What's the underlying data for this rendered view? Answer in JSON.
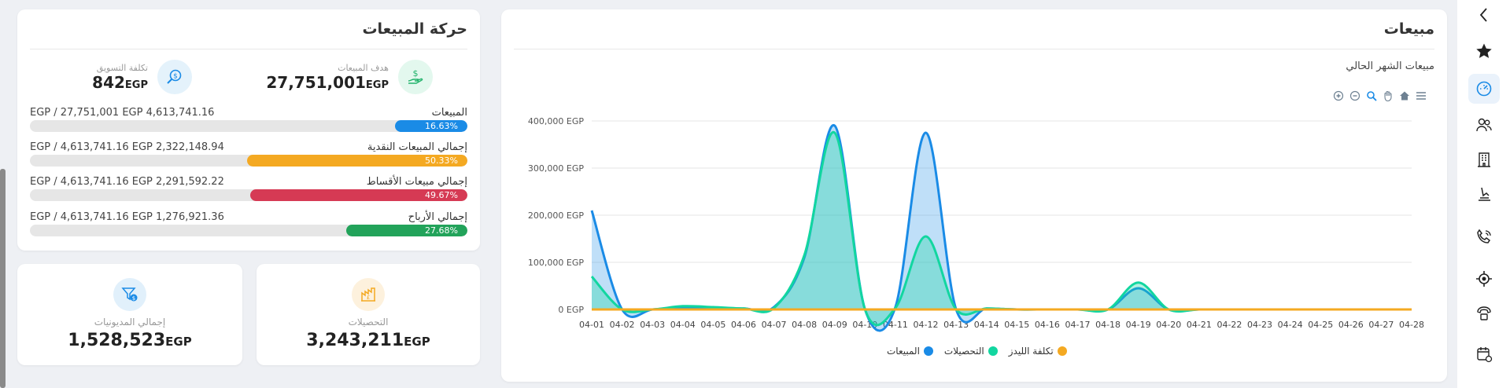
{
  "colors": {
    "sales": "#1a8be6",
    "collections": "#12d6a0",
    "leads_cost": "#f4a922"
  },
  "chart_card": {
    "title": "مبيعات",
    "subtitle": "مبيعات الشهر الحالي",
    "toolbar": [
      "zoom-in-icon",
      "zoom-out-icon",
      "search-zoom-icon",
      "pan-hand-icon",
      "home-icon",
      "menu-icon"
    ]
  },
  "chart_data": {
    "type": "area",
    "x": [
      "04-01",
      "04-02",
      "04-03",
      "04-04",
      "04-05",
      "04-06",
      "04-07",
      "04-08",
      "04-09",
      "04-10",
      "04-11",
      "04-12",
      "04-13",
      "04-14",
      "04-15",
      "04-16",
      "04-17",
      "04-18",
      "04-19",
      "04-20",
      "04-21",
      "04-22",
      "04-23",
      "04-24",
      "04-25",
      "04-26",
      "04-27",
      "04-28"
    ],
    "ylim": [
      0,
      400000
    ],
    "yticks": [
      "0 EGP",
      "100,000 EGP",
      "200,000 EGP",
      "300,000 EGP",
      "400,000 EGP"
    ],
    "grid": true,
    "legend_position": "bottom",
    "series": [
      {
        "name": "المبيعات",
        "values": [
          210000,
          0,
          0,
          5000,
          3000,
          2000,
          5000,
          110000,
          390000,
          0,
          5000,
          375000,
          0,
          2000,
          0,
          0,
          0,
          0,
          45000,
          0,
          0,
          0,
          0,
          0,
          0,
          0,
          0,
          0
        ]
      },
      {
        "name": "التحصيلات",
        "values": [
          70000,
          0,
          0,
          7000,
          5000,
          2000,
          3000,
          115000,
          375000,
          0,
          3000,
          155000,
          0,
          2000,
          0,
          0,
          0,
          0,
          57000,
          0,
          0,
          0,
          0,
          0,
          0,
          0,
          0,
          0
        ]
      },
      {
        "name": "تكلفة الليدز",
        "values": [
          0,
          0,
          0,
          0,
          0,
          0,
          0,
          0,
          0,
          0,
          0,
          0,
          0,
          0,
          0,
          0,
          0,
          0,
          0,
          0,
          0,
          0,
          0,
          0,
          0,
          0,
          0,
          0
        ]
      }
    ]
  },
  "movement_card": {
    "title": "حركة المبيعات",
    "kpi_target": {
      "label": "هدف المبيعات",
      "value": "27,751,001",
      "unit": "EGP",
      "icon": "dollar-hand-icon"
    },
    "kpi_marketing": {
      "label": "تكلفة التسويق",
      "value": "842",
      "unit": "EGP",
      "icon": "search-dollar-icon"
    },
    "rows": [
      {
        "label": "المبيعات",
        "detail": "EGP / 27,751,001 EGP 4,613,741.16",
        "percent": 16.63,
        "percent_label": "16.63%",
        "color": "#1a8be6"
      },
      {
        "label": "إجمالي المبيعات النقدية",
        "detail": "EGP / 4,613,741.16 EGP 2,322,148.94",
        "percent": 50.33,
        "percent_label": "50.33%",
        "color": "#f4a922"
      },
      {
        "label": "إجمالي مبيعات الأقساط",
        "detail": "EGP / 4,613,741.16 EGP 2,291,592.22",
        "percent": 49.67,
        "percent_label": "49.67%",
        "color": "#d63a54"
      },
      {
        "label": "إجمالي الأرباح",
        "detail": "EGP / 4,613,741.16 EGP 1,276,921.36",
        "percent": 27.68,
        "percent_label": "27.68%",
        "color": "#22a35a"
      }
    ]
  },
  "collections_card": {
    "label": "التحصيلات",
    "value": "3,243,211",
    "unit": "EGP",
    "icon": "collections-icon"
  },
  "debts_card": {
    "label": "إجمالي المديونيات",
    "value": "1,528,523",
    "unit": "EGP",
    "icon": "funnel-dollar-icon"
  },
  "sidebar": {
    "items": [
      "chevron-left-icon",
      "star-icon",
      "dashboard-gauge-icon",
      "users-icon",
      "building-icon",
      "installment-icon",
      "phone-icon",
      "target-icon",
      "call-center-icon",
      "calendar-settings-icon"
    ],
    "active": "dashboard-gauge-icon"
  }
}
